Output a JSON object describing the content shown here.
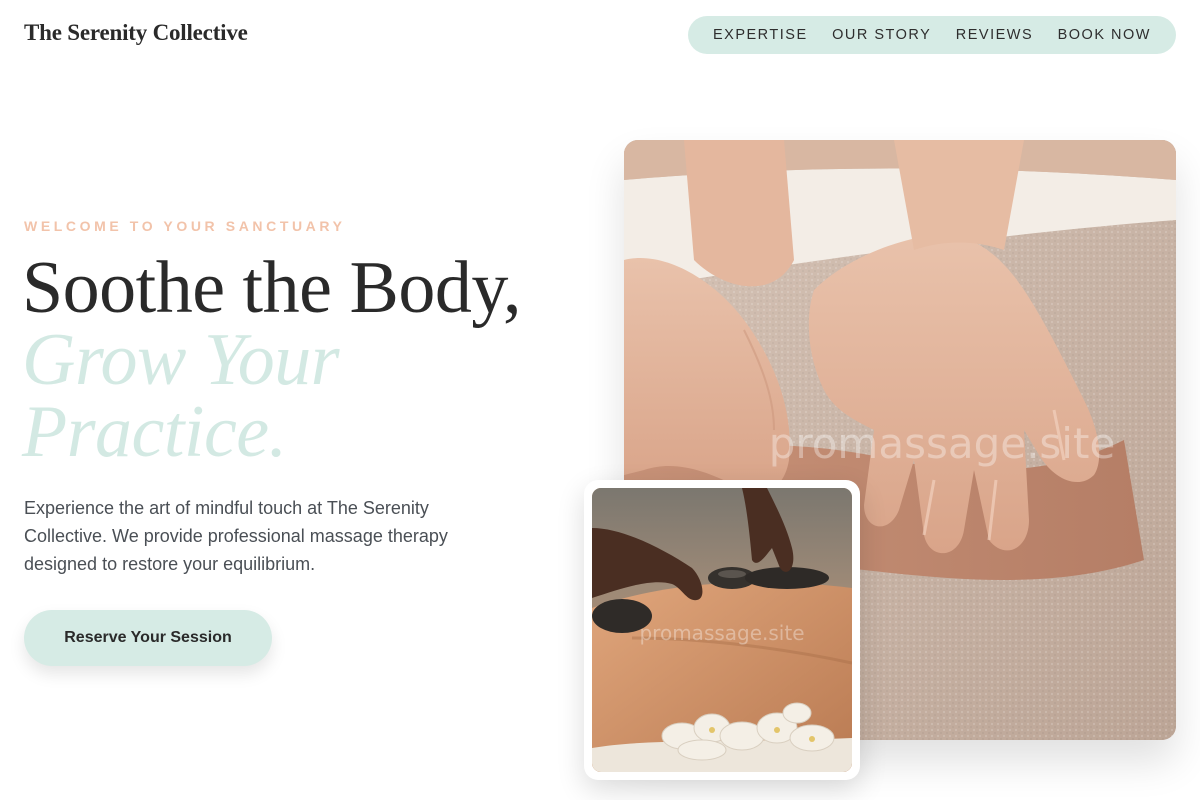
{
  "brand": {
    "name": "The Serenity Collective"
  },
  "nav": {
    "items": [
      {
        "label": "EXPERTISE"
      },
      {
        "label": "OUR STORY"
      },
      {
        "label": "REVIEWS"
      },
      {
        "label": "BOOK NOW"
      }
    ]
  },
  "hero": {
    "eyebrow": "WELCOME TO YOUR SANCTUARY",
    "headline_line1": "Soothe the Body,",
    "headline_accent_line2": "Grow Your",
    "headline_accent_line3": "Practice.",
    "description": "Experience the art of mindful touch at The Serenity Collective. We provide professional massage therapy designed to restore your equilibrium.",
    "cta_label": "Reserve Your Session"
  },
  "images": {
    "main_photo_watermark": "promassage.site",
    "inset_photo_watermark": "promassage.site"
  },
  "colors": {
    "accent_mint": "#d6ebe5",
    "headline_accent": "#d3e9e3",
    "eyebrow_peach": "#f2c3aa",
    "text_dark": "#2a2a2a",
    "body_text": "#4a4f55"
  }
}
